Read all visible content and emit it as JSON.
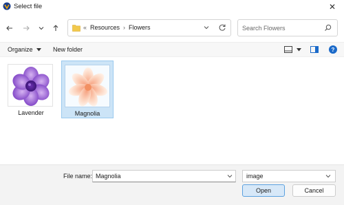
{
  "window": {
    "title": "Select file"
  },
  "nav": {
    "breadcrumb_overflow": "«",
    "breadcrumbs": [
      "Resources",
      "Flowers"
    ],
    "search_placeholder": "Search Flowers"
  },
  "toolbar": {
    "organize_label": "Organize",
    "new_folder_label": "New folder"
  },
  "files": [
    {
      "name": "Lavender",
      "selected": false
    },
    {
      "name": "Magnolia",
      "selected": true
    }
  ],
  "footer": {
    "file_name_label": "File name:",
    "file_name_value": "Magnolia",
    "file_type_value": "image",
    "open_label": "Open",
    "cancel_label": "Cancel"
  },
  "colors": {
    "accent": "#1b6ac9",
    "selection": "#cce4f7",
    "folder": "#f2c94c"
  }
}
